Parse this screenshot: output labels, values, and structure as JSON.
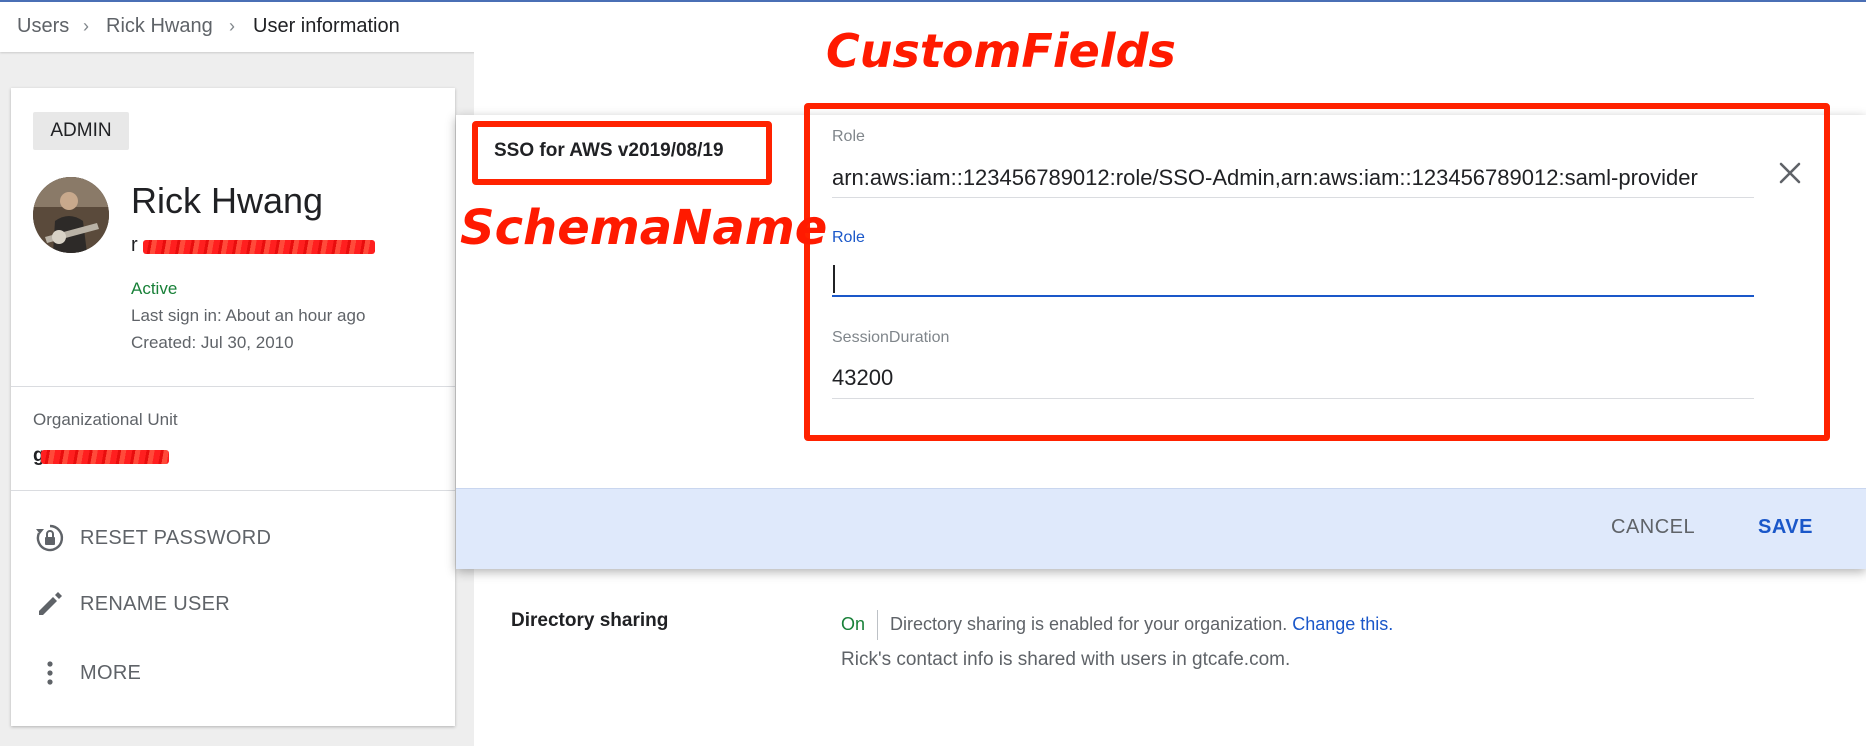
{
  "breadcrumb": {
    "items": [
      "Users",
      "Rick Hwang",
      "User information"
    ]
  },
  "user_card": {
    "role_badge": "ADMIN",
    "name": "Rick Hwang",
    "email_visible_prefix": "r",
    "status": "Active",
    "last_sign_in": "Last sign in: About an hour ago",
    "created": "Created: Jul 30, 2010",
    "org_unit_label": "Organizational Unit",
    "org_unit_visible_prefix": "g",
    "actions": [
      {
        "label": "RESET PASSWORD",
        "icon": "lock-reset-icon"
      },
      {
        "label": "RENAME USER",
        "icon": "pencil-icon"
      },
      {
        "label": "MORE",
        "icon": "more-vert-icon"
      }
    ]
  },
  "dialog": {
    "schema_name": "SSO for AWS v2019/08/19",
    "fields": [
      {
        "label": "Role",
        "value": "arn:aws:iam::123456789012:role/SSO-Admin,arn:aws:iam::123456789012:saml-provider"
      },
      {
        "label": "Role",
        "value": "",
        "focused": true
      },
      {
        "label": "SessionDuration",
        "value": "43200"
      }
    ],
    "cancel_label": "CANCEL",
    "save_label": "SAVE"
  },
  "directory_sharing": {
    "title": "Directory sharing",
    "status": "On",
    "description": "Directory sharing is enabled for your organization.",
    "link": "Change this.",
    "shared_note": "Rick's contact info is shared with users in gtcafe.com."
  },
  "annotations": {
    "custom_fields": "CustomFields",
    "schema_name": "SchemaName"
  },
  "colors": {
    "accent": "#1a57c9",
    "active_green": "#188038",
    "annotation_red": "#ff2200",
    "footer_bg": "#dfe9fb"
  }
}
